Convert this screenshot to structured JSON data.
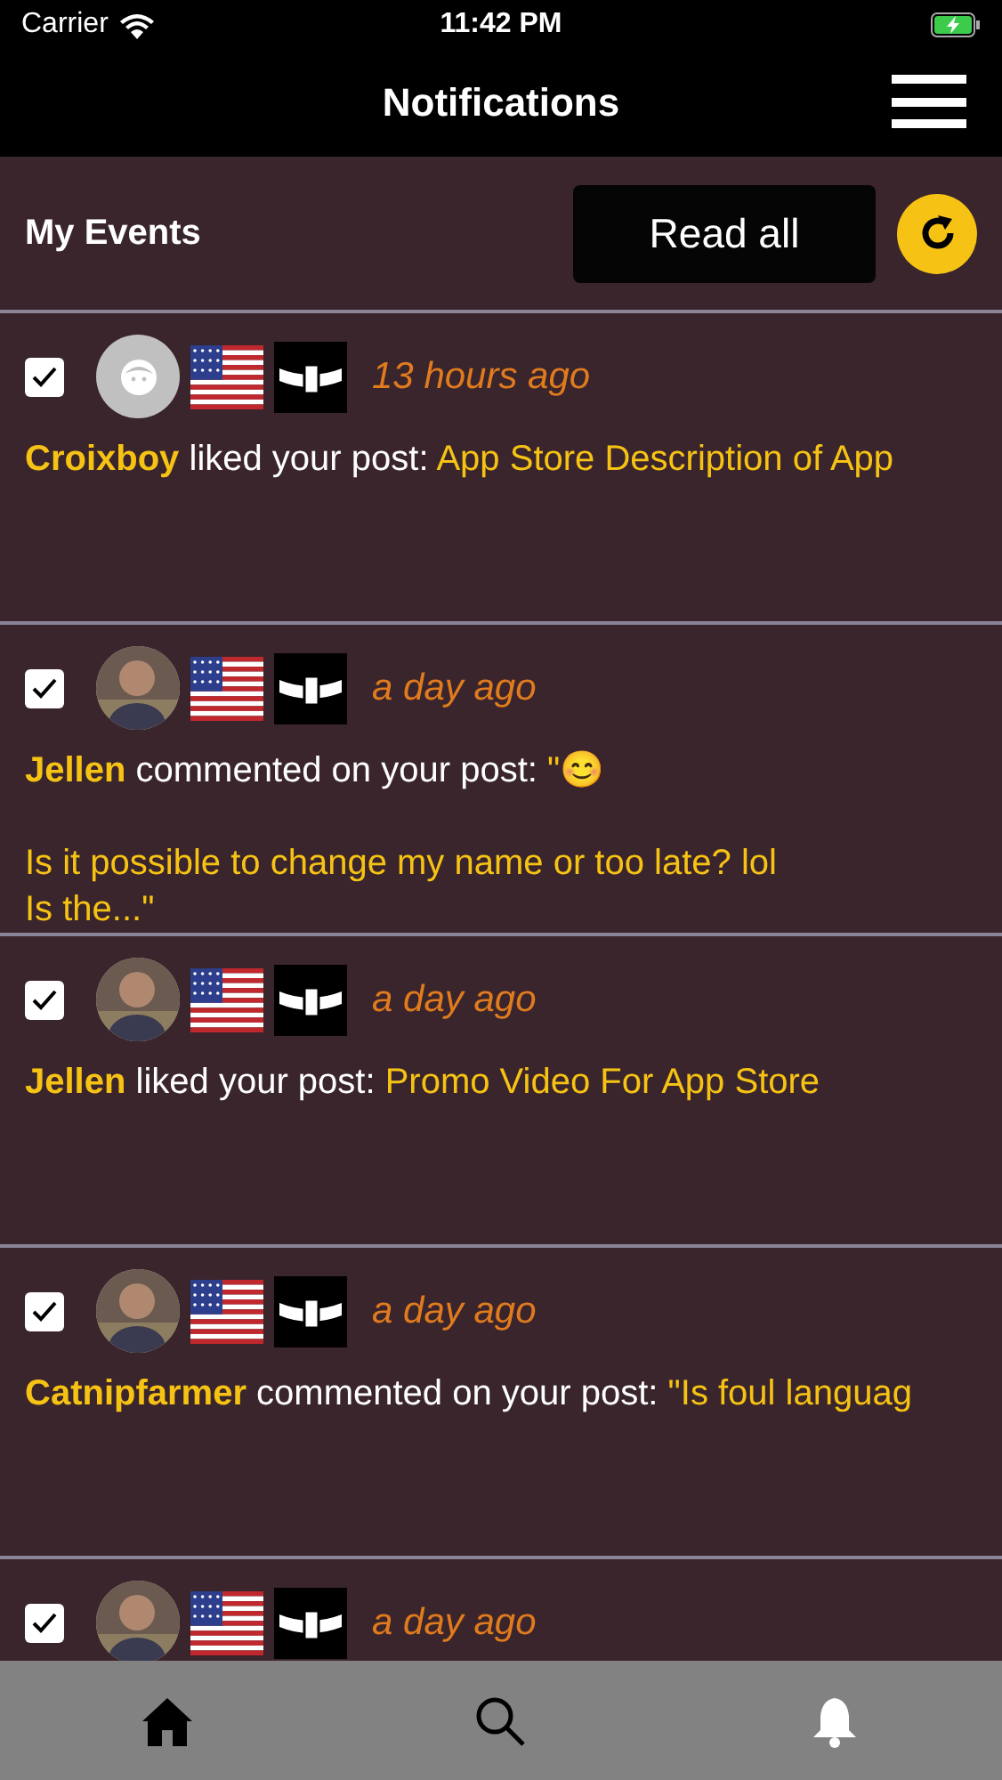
{
  "status_bar": {
    "carrier": "Carrier",
    "time": "11:42 PM"
  },
  "nav": {
    "title": "Notifications"
  },
  "header": {
    "title": "My Events",
    "read_all": "Read all"
  },
  "events": [
    {
      "checked": true,
      "avatar": {
        "kind": "placeholder"
      },
      "time": "13 hours ago",
      "user": "Croixboy",
      "action": "liked your post:",
      "post": "App Store Description of App"
    },
    {
      "checked": true,
      "time": "a day ago",
      "user": "Jellen",
      "action": "commented on your post:",
      "post": "\"😊\n\nIs it possible to change my name or too late? lol\nIs the...\""
    },
    {
      "checked": true,
      "time": "a day ago",
      "user": "Jellen",
      "action": "liked your post:",
      "post": "Promo Video For App Store"
    },
    {
      "checked": true,
      "time": "a day ago",
      "user": "Catnipfarmer",
      "action": "commented on your post:",
      "post": "\"Is foul languag"
    },
    {
      "checked": true,
      "time": "a day ago"
    }
  ],
  "tab_bar": [
    {
      "kind": "home",
      "selected": false
    },
    {
      "kind": "search",
      "selected": false
    },
    {
      "kind": "bell",
      "selected": true
    }
  ]
}
